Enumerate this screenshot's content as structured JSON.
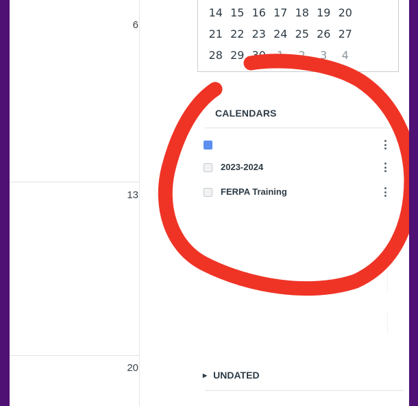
{
  "week_grid": {
    "day_numbers": [
      "6",
      "13",
      "20"
    ]
  },
  "mini_calendar": {
    "rows": [
      [
        {
          "d": "14"
        },
        {
          "d": "15"
        },
        {
          "d": "16"
        },
        {
          "d": "17"
        },
        {
          "d": "18"
        },
        {
          "d": "19"
        },
        {
          "d": "20"
        }
      ],
      [
        {
          "d": "21"
        },
        {
          "d": "22"
        },
        {
          "d": "23"
        },
        {
          "d": "24"
        },
        {
          "d": "25"
        },
        {
          "d": "26"
        },
        {
          "d": "27"
        }
      ],
      [
        {
          "d": "28"
        },
        {
          "d": "29"
        },
        {
          "d": "30"
        },
        {
          "d": "1",
          "other": true
        },
        {
          "d": "2",
          "other": true
        },
        {
          "d": "3",
          "other": true
        },
        {
          "d": "4",
          "other": true
        }
      ]
    ]
  },
  "calendars": {
    "title": "CALENDARS",
    "items": [
      {
        "label": "",
        "checked": true,
        "color": "#5b8ff0"
      },
      {
        "label": "2023-2024",
        "checked": false
      },
      {
        "label": "FERPA Training",
        "checked": false
      }
    ]
  },
  "undated": {
    "label": "UNDATED"
  },
  "colors": {
    "frame": "#4f1173",
    "annotation": "#ef3426",
    "accent_checkbox": "#5b8ff0"
  },
  "icons": {
    "kebab": "kebab-menu-icon",
    "undated_toggle": "caret-right-icon"
  }
}
